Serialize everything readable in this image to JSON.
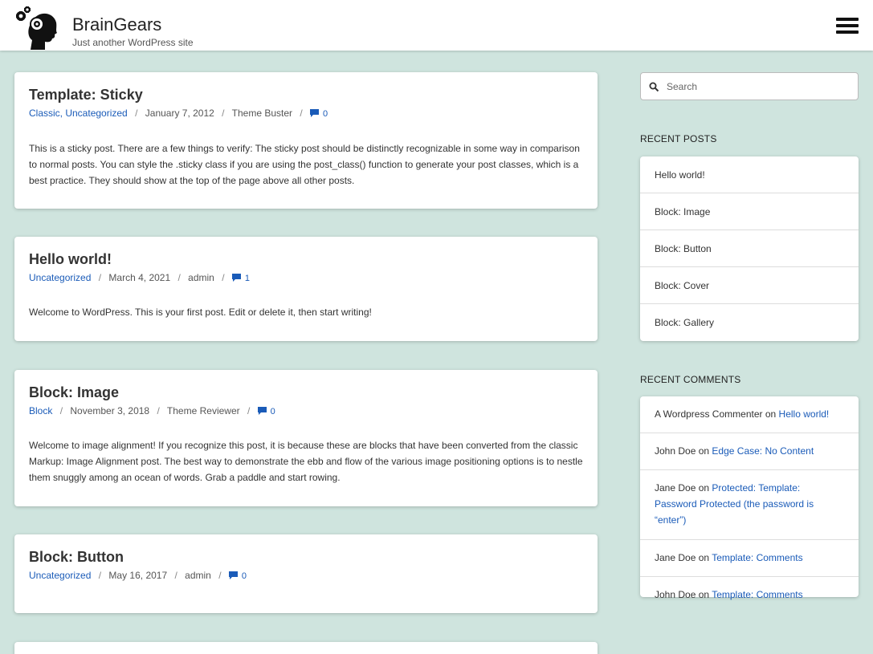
{
  "site": {
    "title": "BrainGears",
    "description": "Just another WordPress site"
  },
  "posts": [
    {
      "title": "Template: Sticky",
      "categories": [
        "Classic",
        "Uncategorized"
      ],
      "date": "January 7, 2012",
      "author": "Theme Buster",
      "comments": "0",
      "excerpt": "This is a sticky post. There are a few things to verify: The sticky post should be distinctly recognizable in some way in comparison to normal posts. You can style the .sticky class if you are using the post_class() function to generate your post classes, which is a best practice. They should show at the top of the page above all other posts."
    },
    {
      "title": "Hello world!",
      "categories": [
        "Uncategorized"
      ],
      "date": "March 4, 2021",
      "author": "admin",
      "comments": "1",
      "excerpt": "Welcome to WordPress. This is your first post. Edit or delete it, then start writing!"
    },
    {
      "title": "Block: Image",
      "categories": [
        "Block"
      ],
      "date": "November 3, 2018",
      "author": "Theme Reviewer",
      "comments": "0",
      "excerpt": "Welcome to image alignment! If you recognize this post, it is because these are blocks that have been converted from the classic Markup: Image Alignment post. The best way to demonstrate the ebb and flow of the various image positioning options is to nestle them snuggly among an ocean of words. Grab a paddle and start rowing."
    },
    {
      "title": "Block: Button",
      "categories": [
        "Uncategorized"
      ],
      "date": "May 16, 2017",
      "author": "admin",
      "comments": "0",
      "excerpt": ""
    }
  ],
  "search": {
    "placeholder": "Search"
  },
  "recent_posts": {
    "title": "RECENT POSTS",
    "items": [
      "Hello world!",
      "Block: Image",
      "Block: Button",
      "Block: Cover",
      "Block: Gallery"
    ]
  },
  "recent_comments": {
    "title": "RECENT COMMENTS",
    "items": [
      {
        "author": "A Wordpress Commenter",
        "on": "on",
        "post": "Hello world!"
      },
      {
        "author": "John Doe",
        "on": "on",
        "post": "Edge Case: No Content"
      },
      {
        "author": "Jane Doe",
        "on": "on",
        "post": "Protected: Template: Password Protected (the password is “enter”)"
      },
      {
        "author": "Jane Doe",
        "on": "on",
        "post": "Template: Comments"
      },
      {
        "author": "John Doe",
        "on": "on",
        "post": "Template: Comments"
      }
    ]
  },
  "colors": {
    "background": "#cfe4de",
    "link": "#1a5bb8"
  }
}
